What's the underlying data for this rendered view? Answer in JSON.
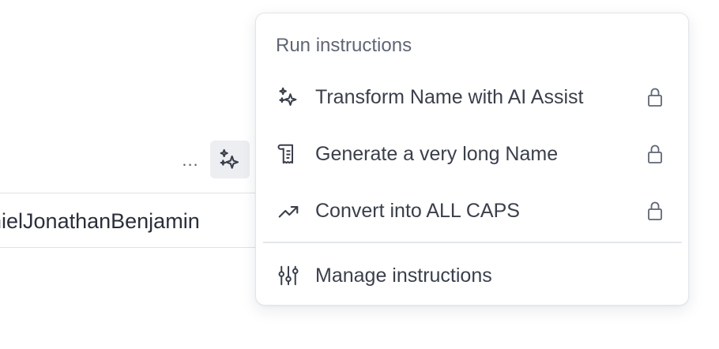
{
  "field": {
    "value": "anielJonathanBenjamin"
  },
  "toolbar": {
    "more_label": "...",
    "ai_icon": "sparkles-icon"
  },
  "menu": {
    "title": "Run instructions",
    "items": [
      {
        "label": "Transform Name with AI Assist",
        "icon": "sparkles-icon",
        "locked": true
      },
      {
        "label": "Generate a very long Name",
        "icon": "scroll-icon",
        "locked": true
      },
      {
        "label": "Convert into ALL CAPS",
        "icon": "trending-up-icon",
        "locked": true
      }
    ],
    "manage_label": "Manage instructions",
    "manage_icon": "sliders-icon"
  },
  "colors": {
    "text": "#3a3f4b",
    "muted": "#5f6675",
    "border": "#e2e5ea",
    "button_bg": "#eceef1"
  }
}
